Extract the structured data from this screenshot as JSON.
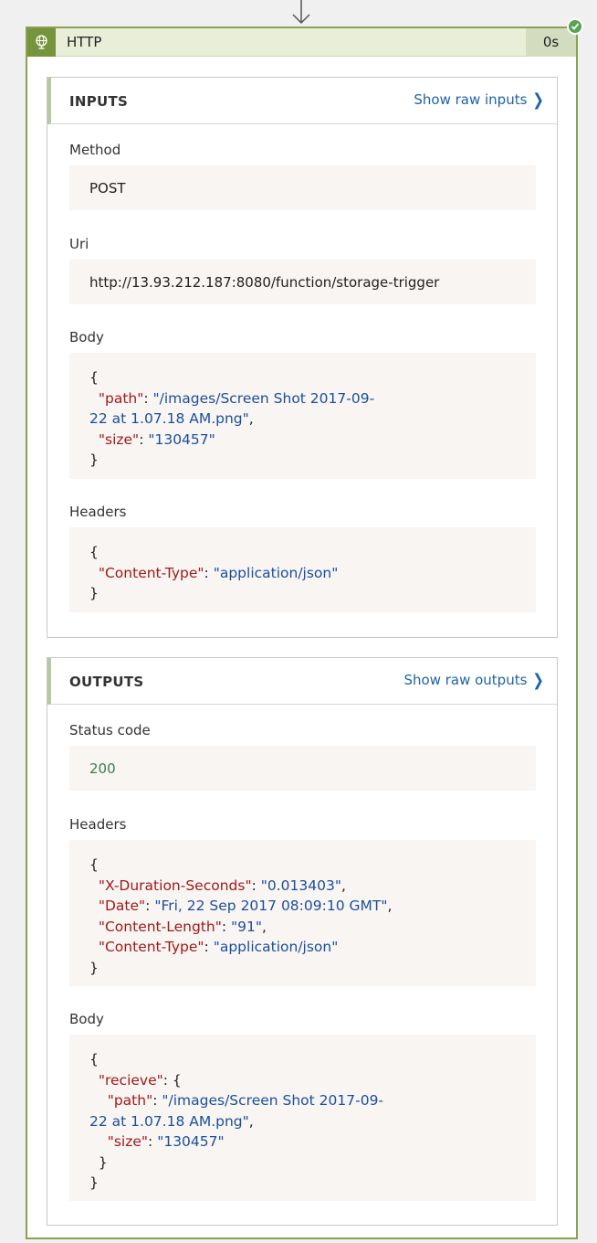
{
  "card": {
    "title": "HTTP",
    "duration": "0s",
    "icon": "globe-icon",
    "status_icon": "success-check-icon",
    "accent_color": "#76943c"
  },
  "inputs": {
    "title": "INPUTS",
    "link": "Show raw inputs",
    "method_label": "Method",
    "method_value": "POST",
    "uri_label": "Uri",
    "uri_value": "http://13.93.212.187:8080/function/storage-trigger",
    "body_label": "Body",
    "body": {
      "open": "{",
      "path_key": "\"path\"",
      "path_value_line1": "\"/images/Screen Shot 2017-09-",
      "path_value_line2": "22 at 1.07.18 AM.png\"",
      "size_key": "\"size\"",
      "size_value": "\"130457\"",
      "close": "}"
    },
    "headers_label": "Headers",
    "headers": {
      "open": "{",
      "ct_key": "\"Content-Type\"",
      "ct_value": "\"application/json\"",
      "close": "}"
    }
  },
  "outputs": {
    "title": "OUTPUTS",
    "link": "Show raw outputs",
    "status_label": "Status code",
    "status_value": "200",
    "headers_label": "Headers",
    "headers": {
      "open": "{",
      "dur_key": "\"X-Duration-Seconds\"",
      "dur_value": "\"0.013403\"",
      "date_key": "\"Date\"",
      "date_value": "\"Fri, 22 Sep 2017 08:09:10 GMT\"",
      "len_key": "\"Content-Length\"",
      "len_value": "\"91\"",
      "ct_key": "\"Content-Type\"",
      "ct_value": "\"application/json\"",
      "close": "}"
    },
    "body_label": "Body",
    "body": {
      "open": "{",
      "recieve_key": "\"recieve\"",
      "inner_open": "{",
      "path_key": "\"path\"",
      "path_value_line1": "\"/images/Screen Shot 2017-09-",
      "path_value_line2": "22 at 1.07.18 AM.png\"",
      "size_key": "\"size\"",
      "size_value": "\"130457\"",
      "inner_close": "}",
      "close": "}"
    }
  }
}
